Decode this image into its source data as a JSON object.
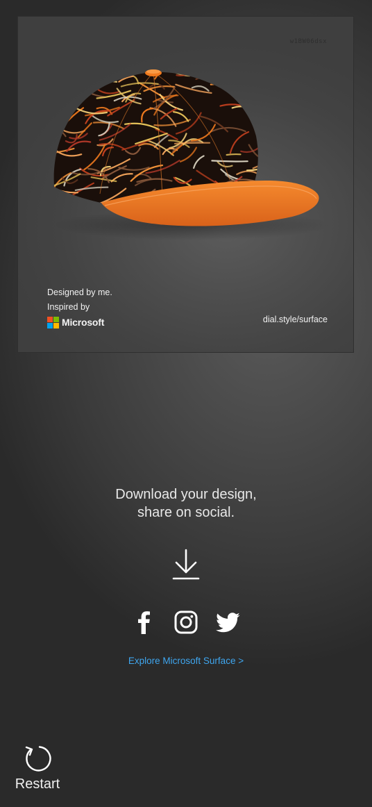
{
  "design": {
    "code": "w1BW06dsx",
    "credit_line1": "Designed by me.",
    "credit_line2": "Inspired by",
    "brand": "Microsoft",
    "url": "dial.style/surface",
    "colors": {
      "brim": "#f07a1e",
      "crown_base": "#1a0f0a",
      "ms_red": "#f25022",
      "ms_green": "#7fba00",
      "ms_blue": "#00a4ef",
      "ms_yellow": "#ffb900"
    }
  },
  "share": {
    "line1": "Download your design,",
    "line2": "share on social.",
    "download_icon": "download-icon",
    "networks": [
      "facebook-icon",
      "instagram-icon",
      "twitter-icon"
    ],
    "explore_link": "Explore Microsoft Surface >",
    "link_color": "#3fa6ef"
  },
  "restart": {
    "label": "Restart",
    "icon": "restart-icon"
  }
}
